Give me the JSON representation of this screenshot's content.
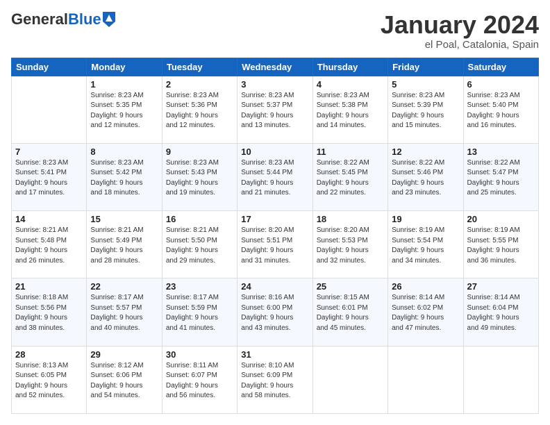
{
  "header": {
    "logo": {
      "general": "General",
      "blue": "Blue"
    },
    "title": "January 2024",
    "location": "el Poal, Catalonia, Spain"
  },
  "weekdays": [
    "Sunday",
    "Monday",
    "Tuesday",
    "Wednesday",
    "Thursday",
    "Friday",
    "Saturday"
  ],
  "weeks": [
    [
      {
        "day": "",
        "info": ""
      },
      {
        "day": "1",
        "info": "Sunrise: 8:23 AM\nSunset: 5:35 PM\nDaylight: 9 hours\nand 12 minutes."
      },
      {
        "day": "2",
        "info": "Sunrise: 8:23 AM\nSunset: 5:36 PM\nDaylight: 9 hours\nand 12 minutes."
      },
      {
        "day": "3",
        "info": "Sunrise: 8:23 AM\nSunset: 5:37 PM\nDaylight: 9 hours\nand 13 minutes."
      },
      {
        "day": "4",
        "info": "Sunrise: 8:23 AM\nSunset: 5:38 PM\nDaylight: 9 hours\nand 14 minutes."
      },
      {
        "day": "5",
        "info": "Sunrise: 8:23 AM\nSunset: 5:39 PM\nDaylight: 9 hours\nand 15 minutes."
      },
      {
        "day": "6",
        "info": "Sunrise: 8:23 AM\nSunset: 5:40 PM\nDaylight: 9 hours\nand 16 minutes."
      }
    ],
    [
      {
        "day": "7",
        "info": "Sunrise: 8:23 AM\nSunset: 5:41 PM\nDaylight: 9 hours\nand 17 minutes."
      },
      {
        "day": "8",
        "info": "Sunrise: 8:23 AM\nSunset: 5:42 PM\nDaylight: 9 hours\nand 18 minutes."
      },
      {
        "day": "9",
        "info": "Sunrise: 8:23 AM\nSunset: 5:43 PM\nDaylight: 9 hours\nand 19 minutes."
      },
      {
        "day": "10",
        "info": "Sunrise: 8:23 AM\nSunset: 5:44 PM\nDaylight: 9 hours\nand 21 minutes."
      },
      {
        "day": "11",
        "info": "Sunrise: 8:22 AM\nSunset: 5:45 PM\nDaylight: 9 hours\nand 22 minutes."
      },
      {
        "day": "12",
        "info": "Sunrise: 8:22 AM\nSunset: 5:46 PM\nDaylight: 9 hours\nand 23 minutes."
      },
      {
        "day": "13",
        "info": "Sunrise: 8:22 AM\nSunset: 5:47 PM\nDaylight: 9 hours\nand 25 minutes."
      }
    ],
    [
      {
        "day": "14",
        "info": "Sunrise: 8:21 AM\nSunset: 5:48 PM\nDaylight: 9 hours\nand 26 minutes."
      },
      {
        "day": "15",
        "info": "Sunrise: 8:21 AM\nSunset: 5:49 PM\nDaylight: 9 hours\nand 28 minutes."
      },
      {
        "day": "16",
        "info": "Sunrise: 8:21 AM\nSunset: 5:50 PM\nDaylight: 9 hours\nand 29 minutes."
      },
      {
        "day": "17",
        "info": "Sunrise: 8:20 AM\nSunset: 5:51 PM\nDaylight: 9 hours\nand 31 minutes."
      },
      {
        "day": "18",
        "info": "Sunrise: 8:20 AM\nSunset: 5:53 PM\nDaylight: 9 hours\nand 32 minutes."
      },
      {
        "day": "19",
        "info": "Sunrise: 8:19 AM\nSunset: 5:54 PM\nDaylight: 9 hours\nand 34 minutes."
      },
      {
        "day": "20",
        "info": "Sunrise: 8:19 AM\nSunset: 5:55 PM\nDaylight: 9 hours\nand 36 minutes."
      }
    ],
    [
      {
        "day": "21",
        "info": "Sunrise: 8:18 AM\nSunset: 5:56 PM\nDaylight: 9 hours\nand 38 minutes."
      },
      {
        "day": "22",
        "info": "Sunrise: 8:17 AM\nSunset: 5:57 PM\nDaylight: 9 hours\nand 40 minutes."
      },
      {
        "day": "23",
        "info": "Sunrise: 8:17 AM\nSunset: 5:59 PM\nDaylight: 9 hours\nand 41 minutes."
      },
      {
        "day": "24",
        "info": "Sunrise: 8:16 AM\nSunset: 6:00 PM\nDaylight: 9 hours\nand 43 minutes."
      },
      {
        "day": "25",
        "info": "Sunrise: 8:15 AM\nSunset: 6:01 PM\nDaylight: 9 hours\nand 45 minutes."
      },
      {
        "day": "26",
        "info": "Sunrise: 8:14 AM\nSunset: 6:02 PM\nDaylight: 9 hours\nand 47 minutes."
      },
      {
        "day": "27",
        "info": "Sunrise: 8:14 AM\nSunset: 6:04 PM\nDaylight: 9 hours\nand 49 minutes."
      }
    ],
    [
      {
        "day": "28",
        "info": "Sunrise: 8:13 AM\nSunset: 6:05 PM\nDaylight: 9 hours\nand 52 minutes."
      },
      {
        "day": "29",
        "info": "Sunrise: 8:12 AM\nSunset: 6:06 PM\nDaylight: 9 hours\nand 54 minutes."
      },
      {
        "day": "30",
        "info": "Sunrise: 8:11 AM\nSunset: 6:07 PM\nDaylight: 9 hours\nand 56 minutes."
      },
      {
        "day": "31",
        "info": "Sunrise: 8:10 AM\nSunset: 6:09 PM\nDaylight: 9 hours\nand 58 minutes."
      },
      {
        "day": "",
        "info": ""
      },
      {
        "day": "",
        "info": ""
      },
      {
        "day": "",
        "info": ""
      }
    ]
  ]
}
